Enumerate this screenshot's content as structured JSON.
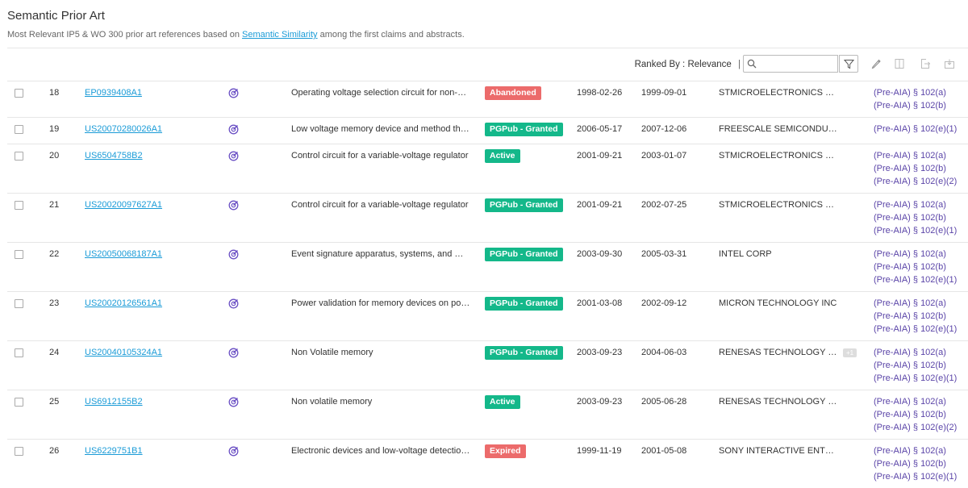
{
  "header": {
    "title": "Semantic Prior Art",
    "subtitle_pre": "Most Relevant IP5 & WO 300 prior art references based on ",
    "subtitle_link": "Semantic Similarity",
    "subtitle_post": " among the first claims and abstracts."
  },
  "toolbar": {
    "ranked_by": "Ranked By : Relevance",
    "separator": "|",
    "search_placeholder": "",
    "search_value": ""
  },
  "colors": {
    "link": "#1a9bd7",
    "law": "#5b45a8",
    "badge_red": "#ec6b6b",
    "badge_green": "#14b88a",
    "semantic_icon": "#6a4fc4"
  },
  "rows": [
    {
      "num": "18",
      "id": "EP0939408A1",
      "title": "Operating voltage selection circuit for non-volatile memory",
      "status": "Abandoned",
      "status_kind": "abandoned",
      "priority": "1998-02-26",
      "pub": "1999-09-01",
      "assignee": "STMICROELECTRONICS S.R.L.",
      "extra": "",
      "laws": [
        "(Pre-AIA) § 102(a)",
        "(Pre-AIA) § 102(b)"
      ]
    },
    {
      "num": "19",
      "id": "US20070280026A1",
      "title": "Low voltage memory device and method thereof",
      "status": "PGPub - Granted",
      "status_kind": "pgpub",
      "priority": "2006-05-17",
      "pub": "2007-12-06",
      "assignee": "FREESCALE SEMICONDUCTOR INC",
      "extra": "",
      "laws": [
        "(Pre-AIA) § 102(e)(1)"
      ]
    },
    {
      "num": "20",
      "id": "US6504758B2",
      "title": "Control circuit for a variable-voltage regulator",
      "status": "Active",
      "status_kind": "active",
      "priority": "2001-09-21",
      "pub": "2003-01-07",
      "assignee": "STMICROELECTRONICS S.R.L.",
      "extra": "",
      "laws": [
        "(Pre-AIA) § 102(a)",
        "(Pre-AIA) § 102(b)",
        "(Pre-AIA) § 102(e)(2)"
      ]
    },
    {
      "num": "21",
      "id": "US20020097627A1",
      "title": "Control circuit for a variable-voltage regulator",
      "status": "PGPub - Granted",
      "status_kind": "pgpub",
      "priority": "2001-09-21",
      "pub": "2002-07-25",
      "assignee": "STMICROELECTRONICS S.R.L.",
      "extra": "",
      "laws": [
        "(Pre-AIA) § 102(a)",
        "(Pre-AIA) § 102(b)",
        "(Pre-AIA) § 102(e)(1)"
      ]
    },
    {
      "num": "22",
      "id": "US20050068187A1",
      "title": "Event signature apparatus, systems, and methods",
      "status": "PGPub - Granted",
      "status_kind": "pgpub",
      "priority": "2003-09-30",
      "pub": "2005-03-31",
      "assignee": "INTEL CORP",
      "extra": "",
      "laws": [
        "(Pre-AIA) § 102(a)",
        "(Pre-AIA) § 102(b)",
        "(Pre-AIA) § 102(e)(1)"
      ]
    },
    {
      "num": "23",
      "id": "US20020126561A1",
      "title": "Power validation for memory devices on power up",
      "status": "PGPub - Granted",
      "status_kind": "pgpub",
      "priority": "2001-03-08",
      "pub": "2002-09-12",
      "assignee": "MICRON TECHNOLOGY INC",
      "extra": "",
      "laws": [
        "(Pre-AIA) § 102(a)",
        "(Pre-AIA) § 102(b)",
        "(Pre-AIA) § 102(e)(1)"
      ]
    },
    {
      "num": "24",
      "id": "US20040105324A1",
      "title": "Non Volatile memory",
      "status": "PGPub - Granted",
      "status_kind": "pgpub",
      "priority": "2003-09-23",
      "pub": "2004-06-03",
      "assignee": "RENESAS TECHNOLOGY CORP",
      "extra": "+1",
      "laws": [
        "(Pre-AIA) § 102(a)",
        "(Pre-AIA) § 102(b)",
        "(Pre-AIA) § 102(e)(1)"
      ]
    },
    {
      "num": "25",
      "id": "US6912155B2",
      "title": "Non volatile memory",
      "status": "Active",
      "status_kind": "active",
      "priority": "2003-09-23",
      "pub": "2005-06-28",
      "assignee": "RENESAS TECHNOLOGY CORP",
      "extra": "",
      "laws": [
        "(Pre-AIA) § 102(a)",
        "(Pre-AIA) § 102(b)",
        "(Pre-AIA) § 102(e)(2)"
      ]
    },
    {
      "num": "26",
      "id": "US6229751B1",
      "title": "Electronic devices and low-voltage detection method",
      "status": "Expired",
      "status_kind": "expired",
      "priority": "1999-11-19",
      "pub": "2001-05-08",
      "assignee": "SONY INTERACTIVE ENTERTAINMENT INC",
      "extra": "",
      "laws": [
        "(Pre-AIA) § 102(a)",
        "(Pre-AIA) § 102(b)",
        "(Pre-AIA) § 102(e)(1)"
      ]
    }
  ]
}
